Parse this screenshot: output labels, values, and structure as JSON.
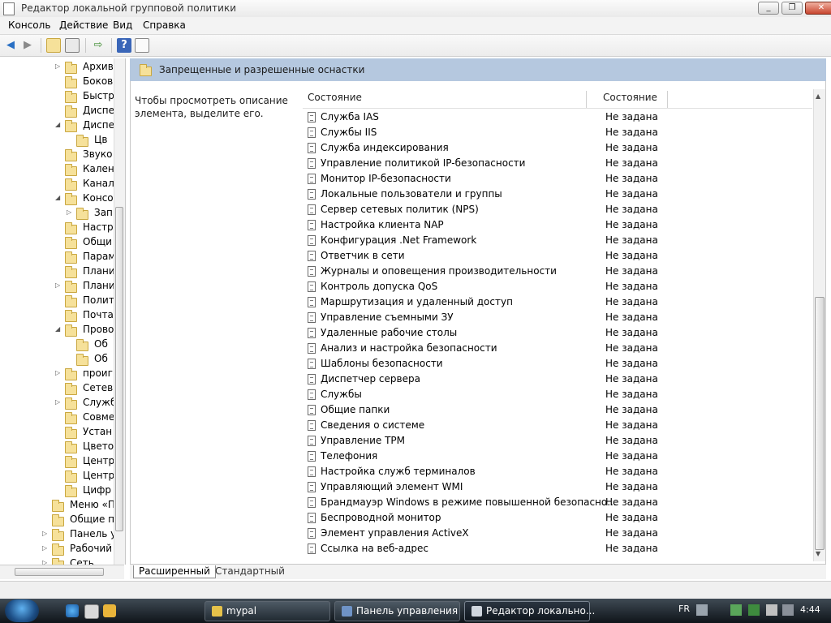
{
  "window": {
    "title": "Редактор локальной групповой политики",
    "minimize": "_",
    "maximize": "❐",
    "close": "✕"
  },
  "menu": [
    "Консоль",
    "Действие",
    "Вид",
    "Справка"
  ],
  "toolbar": [
    "back-arrow-icon",
    "forward-arrow-icon",
    "up-folder-icon",
    "show-hide-tree-icon",
    "export-list-icon",
    "help-icon",
    "properties-icon"
  ],
  "tree": {
    "items": [
      {
        "label": "Архива",
        "expander": "▷"
      },
      {
        "label": "Боковь",
        "expander": ""
      },
      {
        "label": "Быстр",
        "expander": ""
      },
      {
        "label": "Диспе",
        "expander": ""
      },
      {
        "label": "Диспе",
        "expander": "◢"
      },
      {
        "label": "Цв",
        "expander": ""
      },
      {
        "label": "Звуко",
        "expander": ""
      },
      {
        "label": "Кален",
        "expander": ""
      },
      {
        "label": "Канал",
        "expander": ""
      },
      {
        "label": "Консо",
        "expander": "◢"
      },
      {
        "label": "Зап",
        "expander": "▷"
      },
      {
        "label": "Настр",
        "expander": ""
      },
      {
        "label": "Общи",
        "expander": ""
      },
      {
        "label": "Парам",
        "expander": ""
      },
      {
        "label": "Плани",
        "expander": ""
      },
      {
        "label": "Плани",
        "expander": "▷"
      },
      {
        "label": "Полит",
        "expander": ""
      },
      {
        "label": "Почта",
        "expander": ""
      },
      {
        "label": "Прово",
        "expander": "◢"
      },
      {
        "label": "Об",
        "expander": ""
      },
      {
        "label": "Об",
        "expander": ""
      },
      {
        "label": "проиг",
        "expander": "▷"
      },
      {
        "label": "Сетев",
        "expander": ""
      },
      {
        "label": "Служб",
        "expander": "▷"
      },
      {
        "label": "Совме",
        "expander": ""
      },
      {
        "label": "Устан",
        "expander": ""
      },
      {
        "label": "Цвето",
        "expander": ""
      },
      {
        "label": "Центр",
        "expander": ""
      },
      {
        "label": "Центр",
        "expander": ""
      },
      {
        "label": "Цифр",
        "expander": ""
      },
      {
        "label": "Меню «П",
        "expander": ""
      },
      {
        "label": "Общие па",
        "expander": ""
      },
      {
        "label": "Панель уп",
        "expander": "▷"
      },
      {
        "label": "Рабочий с",
        "expander": "▷"
      },
      {
        "label": "Сеть",
        "expander": "▷"
      }
    ]
  },
  "right_pane": {
    "header": "Запрещенные и разрешенные оснастки",
    "description": "Чтобы просмотреть описание элемента, выделите его.",
    "columns": [
      "Состояние",
      "Состояние"
    ],
    "rows": [
      {
        "name": "Служба IAS",
        "state": "Не задана"
      },
      {
        "name": "Службы IIS",
        "state": "Не задана"
      },
      {
        "name": "Служба индексирования",
        "state": "Не задана"
      },
      {
        "name": "Управление политикой IP-безопасности",
        "state": "Не задана"
      },
      {
        "name": "Монитор IP-безопасности",
        "state": "Не задана"
      },
      {
        "name": "Локальные пользователи и группы",
        "state": "Не задана"
      },
      {
        "name": "Сервер сетевых политик (NPS)",
        "state": "Не задана"
      },
      {
        "name": "Настройка клиента NAP",
        "state": "Не задана"
      },
      {
        "name": "Конфигурация .Net Framework",
        "state": "Не задана"
      },
      {
        "name": "Ответчик в сети",
        "state": "Не задана"
      },
      {
        "name": "Журналы и оповещения производительности",
        "state": "Не задана"
      },
      {
        "name": "Контроль допуска QoS",
        "state": "Не задана"
      },
      {
        "name": "Маршрутизация и удаленный доступ",
        "state": "Не задана"
      },
      {
        "name": "Управление съемными ЗУ",
        "state": "Не задана"
      },
      {
        "name": "Удаленные рабочие столы",
        "state": "Не задана"
      },
      {
        "name": "Анализ и настройка безопасности",
        "state": "Не задана"
      },
      {
        "name": "Шаблоны безопасности",
        "state": "Не задана"
      },
      {
        "name": "Диспетчер сервера",
        "state": "Не задана"
      },
      {
        "name": "Службы",
        "state": "Не задана"
      },
      {
        "name": "Общие папки",
        "state": "Не задана"
      },
      {
        "name": "Сведения о системе",
        "state": "Не задана"
      },
      {
        "name": "Управление TPM",
        "state": "Не задана"
      },
      {
        "name": "Телефония",
        "state": "Не задана"
      },
      {
        "name": "Настройка служб терминалов",
        "state": "Не задана"
      },
      {
        "name": "Управляющий элемент WMI",
        "state": "Не задана"
      },
      {
        "name": "Брандмауэр Windows в режиме повышенной безопасно...",
        "state": "Не задана"
      },
      {
        "name": "Беспроводной монитор",
        "state": "Не задана"
      },
      {
        "name": "Элемент управления ActiveX",
        "state": "Не задана"
      },
      {
        "name": "Ссылка на веб-адрес",
        "state": "Не задана"
      }
    ]
  },
  "tabs": [
    "Расширенный",
    "Стандартный"
  ],
  "taskbar": {
    "buttons": [
      {
        "label": "mypal",
        "icon": "browser-icon"
      },
      {
        "label": "Панель управления",
        "icon": "control-panel-icon"
      },
      {
        "label": "Редактор локально...",
        "icon": "policy-editor-icon"
      }
    ],
    "language": "FR",
    "time": "4:44"
  },
  "colors": {
    "header_band": "#b5c8df",
    "folder": "#f6e19a",
    "taskbar": "#1b232b"
  }
}
